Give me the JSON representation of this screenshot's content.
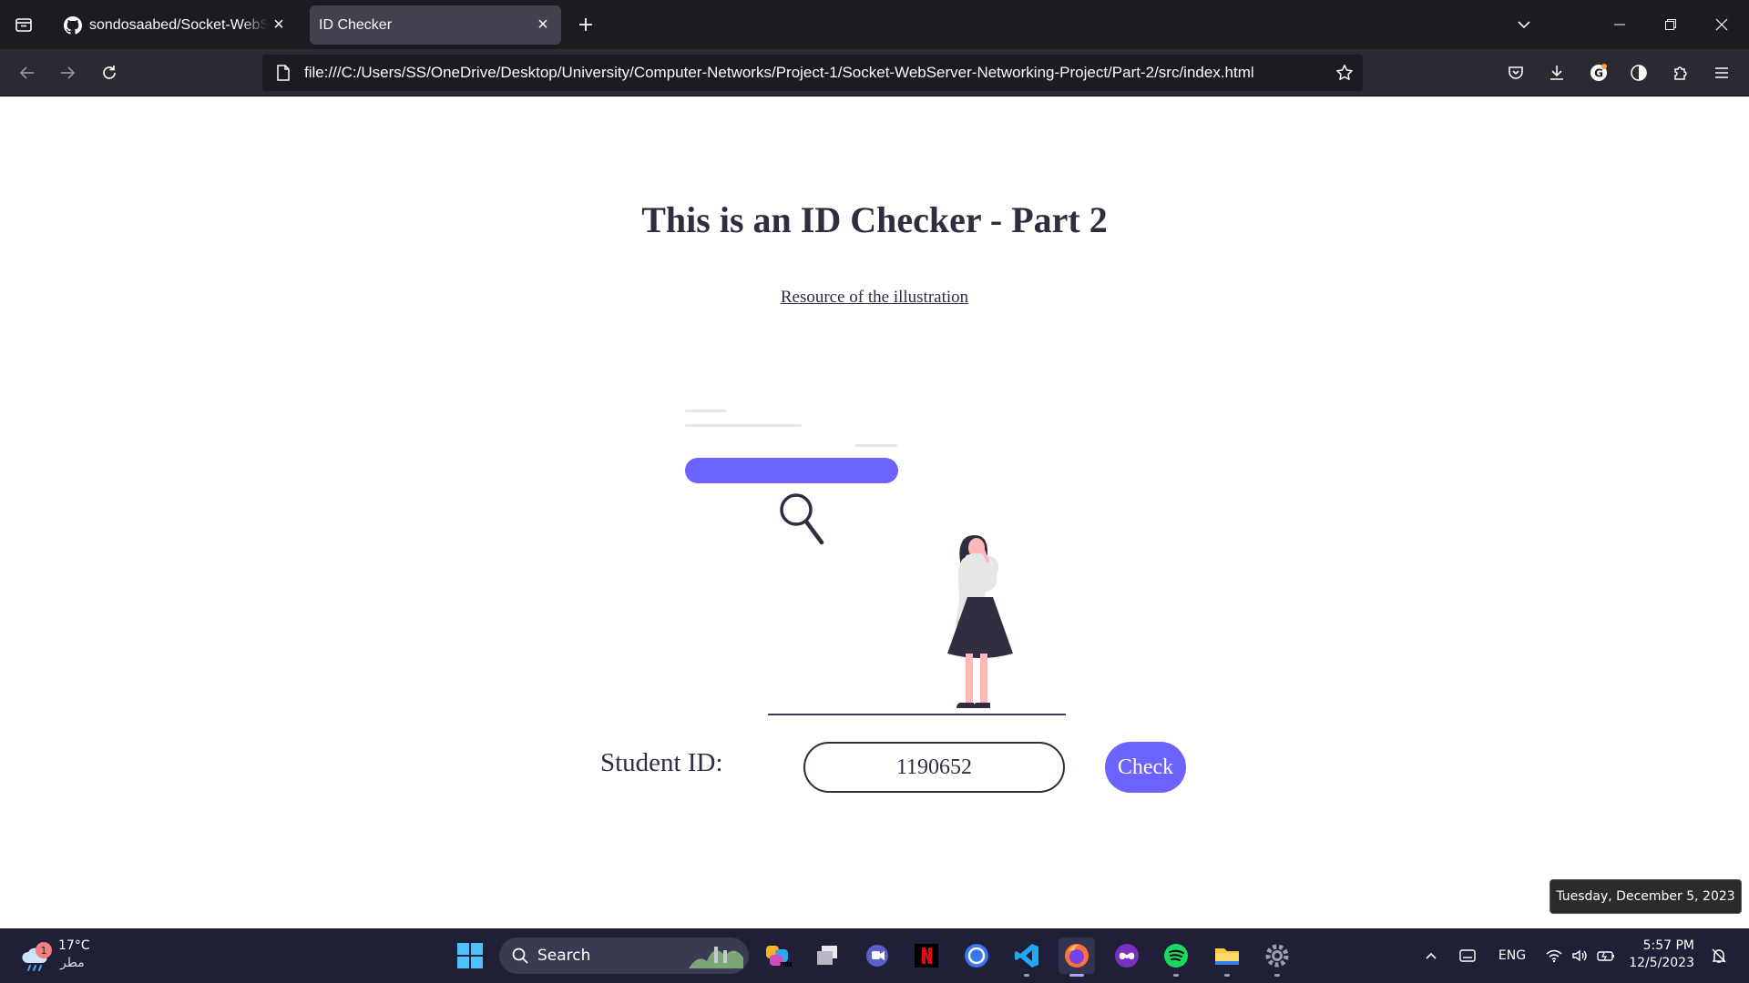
{
  "browser": {
    "tabs": [
      {
        "title": "sondosaabed/Socket-WebServer-Networking-Project",
        "active": false,
        "icon": "github-icon"
      },
      {
        "title": "ID Checker",
        "active": true,
        "icon": "none"
      }
    ],
    "url": "file:///C:/Users/SS/OneDrive/Desktop/University/Computer-Networks/Project-1/Socket-WebServer-Networking-Project/Part-2/src/index.html"
  },
  "page": {
    "title": "This is an ID Checker - Part 2",
    "resource_link": "Resource of the illustration",
    "student_id_label": "Student ID:",
    "student_id_value": "1190652",
    "check_button": "Check",
    "accent_color": "#6c63ff",
    "text_color": "#2f2e41"
  },
  "tooltip": {
    "date_full": "Tuesday, December 5, 2023"
  },
  "taskbar": {
    "weather": {
      "temp": "17°C",
      "condition": "مطر",
      "badge": "1"
    },
    "search_label": "Search",
    "language": "ENG",
    "time": "5:57 PM",
    "date": "12/5/2023",
    "pinned_apps": [
      "copilot-icon",
      "task-view-icon",
      "teams-icon",
      "netflix-icon",
      "signal-icon",
      "vscode-icon",
      "firefox-icon",
      "game-icon",
      "spotify-icon",
      "file-explorer-icon",
      "settings-icon"
    ]
  }
}
